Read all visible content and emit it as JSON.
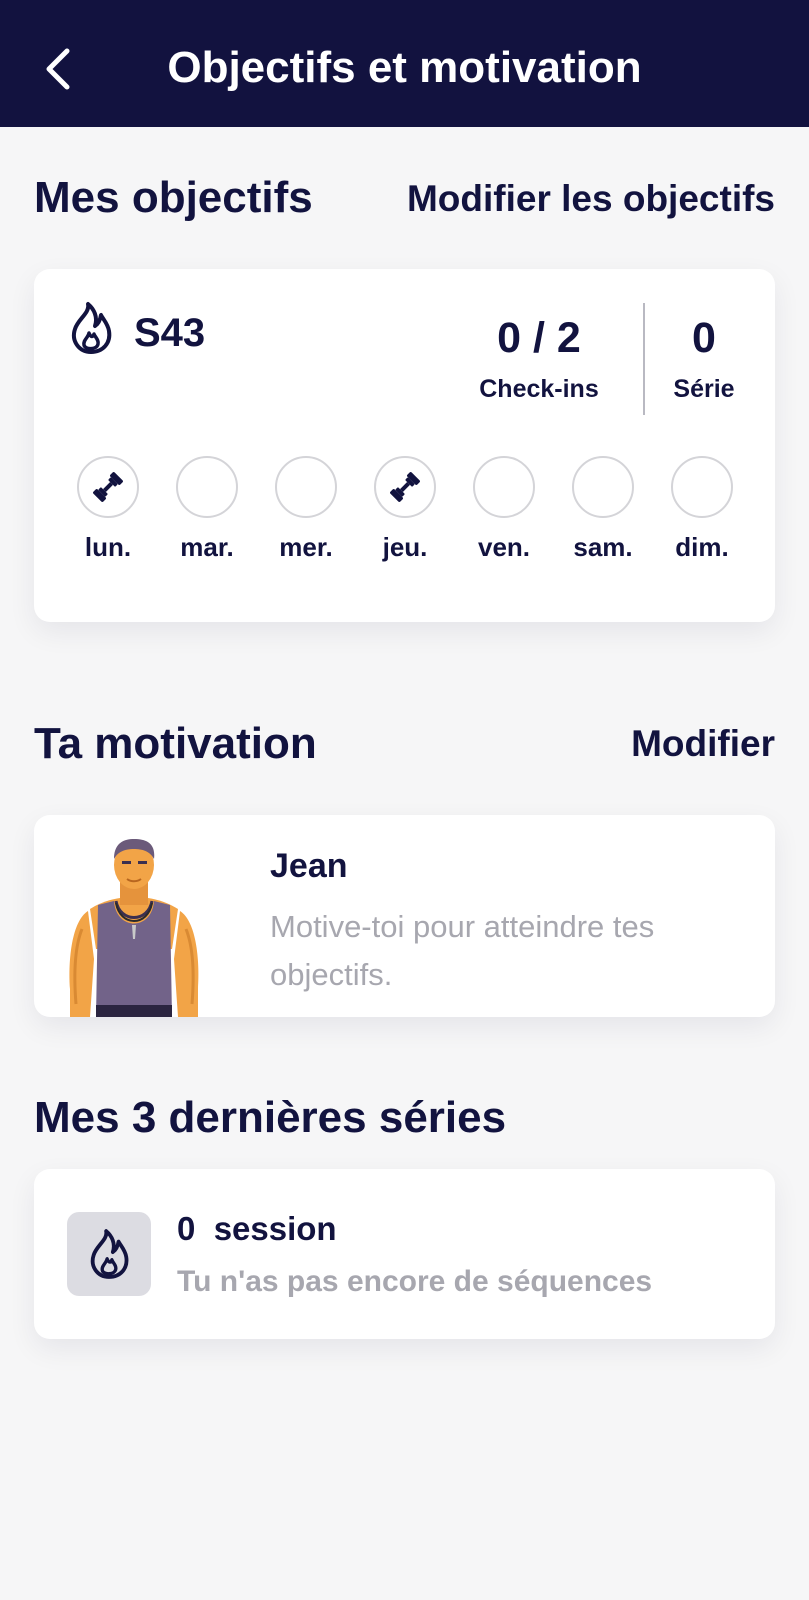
{
  "header": {
    "title": "Objectifs et motivation",
    "back_icon": "chevron-left-icon"
  },
  "goals": {
    "title": "Mes objectifs",
    "edit_link": "Modifier les objectifs",
    "week_icon": "flame-icon",
    "week": "S43",
    "checkins_value": "0 / 2",
    "checkins_label": "Check-ins",
    "streak_value": "0",
    "streak_label": "Série",
    "days": [
      {
        "label": "lun.",
        "checked": true
      },
      {
        "label": "mar.",
        "checked": false
      },
      {
        "label": "mer.",
        "checked": false
      },
      {
        "label": "jeu.",
        "checked": true
      },
      {
        "label": "ven.",
        "checked": false
      },
      {
        "label": "sam.",
        "checked": false
      },
      {
        "label": "dim.",
        "checked": false
      }
    ],
    "checked_icon": "dumbbell-icon"
  },
  "motivation": {
    "title": "Ta motivation",
    "edit_link": "Modifier",
    "coach_name": "Jean",
    "coach_description": "Motive-toi pour atteindre tes objectifs."
  },
  "streaks": {
    "title": "Mes 3 dernières séries",
    "icon": "flame-icon",
    "count": "0  session",
    "description": "Tu n'as pas encore de séquences"
  },
  "colors": {
    "primary": "#12123f",
    "background": "#f6f6f7",
    "card": "#ffffff",
    "muted_text": "#a7a7af",
    "circle_border": "#d4d4d8",
    "icon_box": "#dcdce2"
  }
}
